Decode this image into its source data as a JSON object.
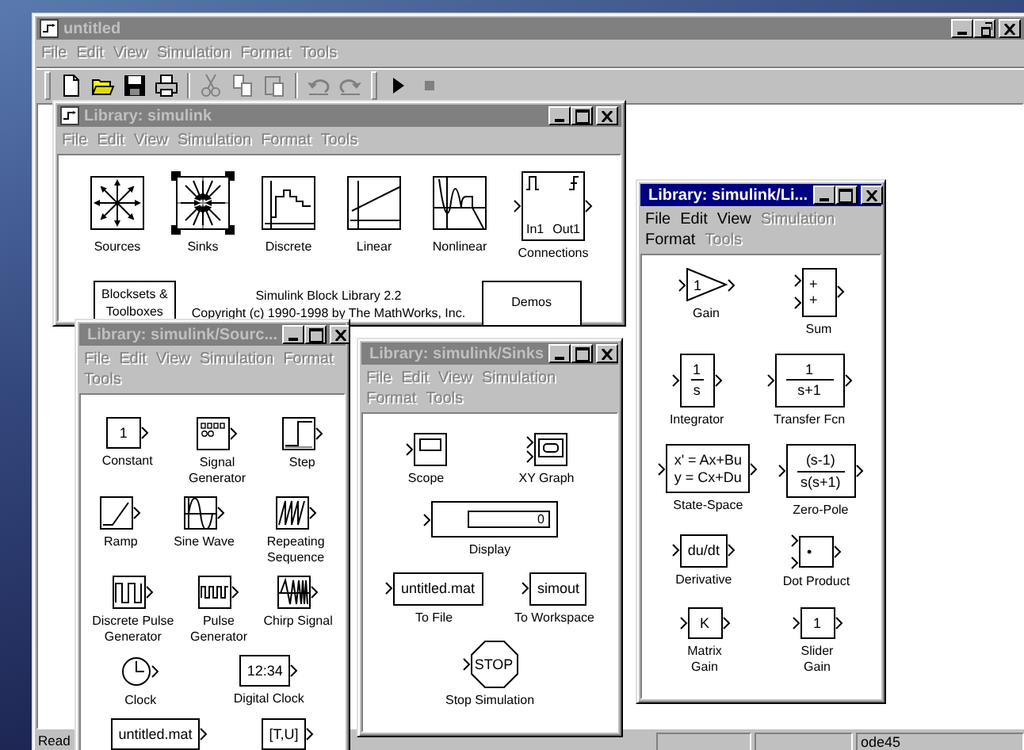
{
  "windows": [
    {
      "kind": "model",
      "title": "untitled",
      "active": false,
      "maximized": true,
      "menu": [
        {
          "label": "File",
          "disabled": true
        },
        {
          "label": "Edit",
          "disabled": true
        },
        {
          "label": "View",
          "disabled": true
        },
        {
          "label": "Simulation",
          "disabled": true
        },
        {
          "label": "Format",
          "disabled": true
        },
        {
          "label": "Tools",
          "disabled": true
        }
      ],
      "toolbar": [
        [
          {
            "kind": "new",
            "disabled": false
          },
          {
            "kind": "open",
            "disabled": false
          },
          {
            "kind": "save",
            "disabled": false
          },
          {
            "kind": "print",
            "disabled": false
          }
        ],
        [
          {
            "kind": "cut",
            "disabled": true
          },
          {
            "kind": "copy",
            "disabled": true
          },
          {
            "kind": "paste",
            "disabled": true
          }
        ],
        [
          {
            "kind": "undo",
            "disabled": true
          },
          {
            "kind": "redo",
            "disabled": true
          }
        ],
        [
          {
            "kind": "start",
            "disabled": false
          },
          {
            "kind": "stop",
            "disabled": true
          }
        ]
      ],
      "status_bar": {
        "message": "Read",
        "solver": "ode45"
      }
    },
    {
      "kind": "library",
      "title": "Library: simulink",
      "active": false,
      "maximized": false,
      "menu": [
        {
          "label": "File",
          "disabled": true
        },
        {
          "label": "Edit",
          "disabled": true
        },
        {
          "label": "View",
          "disabled": true
        },
        {
          "label": "Simulation",
          "disabled": true
        },
        {
          "label": "Format",
          "disabled": true
        },
        {
          "label": "Tools",
          "disabled": true
        }
      ],
      "rows": [
        [
          {
            "label": "Sources",
            "kind": "sources",
            "selected": false
          },
          {
            "label": "Sinks",
            "kind": "sinks",
            "selected": true
          },
          {
            "label": "Discrete",
            "kind": "discrete",
            "selected": false
          },
          {
            "label": "Linear",
            "kind": "linear",
            "selected": false
          },
          {
            "label": "Nonlinear",
            "kind": "nonlinear",
            "selected": false
          },
          {
            "label": "Connections",
            "kind": "connections",
            "lines": [
              "In1",
              "Out1"
            ],
            "selected": false
          }
        ]
      ],
      "footer": {
        "blocksets": "Blocksets &\nToolboxes",
        "caption": "Simulink Block Library 2.2\nCopyright (c) 1990-1998 by The MathWorks, Inc.",
        "demos": "Demos"
      }
    },
    {
      "kind": "library",
      "title": "Library: simulink/Sourc...",
      "active": false,
      "maximized": false,
      "menu": [
        {
          "label": "File",
          "disabled": true
        },
        {
          "label": "Edit",
          "disabled": true
        },
        {
          "label": "View",
          "disabled": true
        },
        {
          "label": "Simulation",
          "disabled": true
        },
        {
          "label": "Format",
          "disabled": true
        },
        {
          "label": "Tools",
          "disabled": true
        }
      ],
      "rows": [
        [
          {
            "label": "Constant",
            "kind": "source-box",
            "lines": [
              "1"
            ]
          },
          {
            "label": "Signal\nGenerator",
            "kind": "signal-generator"
          },
          {
            "label": "Step",
            "kind": "step"
          }
        ],
        [
          {
            "label": "Ramp",
            "kind": "ramp"
          },
          {
            "label": "Sine Wave",
            "kind": "sine"
          },
          {
            "label": "Repeating\nSequence",
            "kind": "repeating"
          }
        ],
        [
          {
            "label": "Discrete Pulse\nGenerator",
            "kind": "discrete-pulse"
          },
          {
            "label": "Pulse\nGenerator",
            "kind": "pulse"
          },
          {
            "label": "Chirp Signal",
            "kind": "chirp"
          }
        ],
        [
          {
            "label": "Clock",
            "kind": "clock"
          },
          {
            "label": "Digital Clock",
            "kind": "source-box",
            "lines": [
              "12:34"
            ]
          }
        ],
        [
          {
            "kind": "source-box",
            "lines": [
              "untitled.mat"
            ]
          },
          {
            "kind": "source-box",
            "lines": [
              "[T,U]"
            ]
          }
        ]
      ]
    },
    {
      "kind": "library",
      "title": "Library: simulink/Sinks",
      "active": false,
      "maximized": false,
      "menu": [
        {
          "label": "File",
          "disabled": true
        },
        {
          "label": "Edit",
          "disabled": true
        },
        {
          "label": "View",
          "disabled": true
        },
        {
          "label": "Simulation",
          "disabled": true
        },
        {
          "label": "Format",
          "disabled": true
        },
        {
          "label": "Tools",
          "disabled": true
        }
      ],
      "rows": [
        [
          {
            "label": "Scope",
            "kind": "scope"
          },
          {
            "label": "XY Graph",
            "kind": "xy-graph"
          }
        ],
        [
          {
            "label": "Display",
            "kind": "display",
            "lines": [
              "0"
            ]
          }
        ],
        [
          {
            "label": "To File",
            "kind": "sink-box",
            "lines": [
              "untitled.mat"
            ]
          },
          {
            "label": "To Workspace",
            "kind": "sink-box",
            "lines": [
              "simout"
            ]
          }
        ],
        [
          {
            "label": "Stop Simulation",
            "kind": "stop",
            "lines": [
              "STOP"
            ]
          }
        ]
      ]
    },
    {
      "kind": "library",
      "title": "Library: simulink/Li...",
      "active": true,
      "maximized": false,
      "menu": [
        {
          "label": "File",
          "disabled": false
        },
        {
          "label": "Edit",
          "disabled": false
        },
        {
          "label": "View",
          "disabled": false
        },
        {
          "label": "Simulation",
          "disabled": true
        },
        {
          "label": "Format",
          "disabled": false
        },
        {
          "label": "Tools",
          "disabled": true
        }
      ],
      "rows": [
        [
          {
            "label": "Gain",
            "kind": "gain",
            "lines": [
              "1"
            ]
          },
          {
            "label": "Sum",
            "kind": "box2",
            "lines": [
              "+",
              "+"
            ]
          }
        ],
        [
          {
            "label": "Integrator",
            "kind": "fraction",
            "lines": [
              "1",
              "s"
            ]
          },
          {
            "label": "Transfer Fcn",
            "kind": "fraction",
            "lines": [
              "1",
              "s+1"
            ]
          }
        ],
        [
          {
            "label": "State-Space",
            "kind": "box",
            "lines": [
              "x' = Ax+Bu",
              "y = Cx+Du"
            ]
          },
          {
            "label": "Zero-Pole",
            "kind": "fraction",
            "lines": [
              "(s-1)",
              "s(s+1)"
            ]
          }
        ],
        [
          {
            "label": "Derivative",
            "kind": "box",
            "lines": [
              "du/dt"
            ]
          },
          {
            "label": "Dot Product",
            "kind": "box2",
            "lines": [
              "•"
            ]
          }
        ],
        [
          {
            "label": "Matrix\nGain",
            "kind": "box",
            "lines": [
              "K"
            ]
          },
          {
            "label": "Slider\nGain",
            "kind": "box",
            "lines": [
              "1"
            ]
          }
        ]
      ]
    }
  ]
}
